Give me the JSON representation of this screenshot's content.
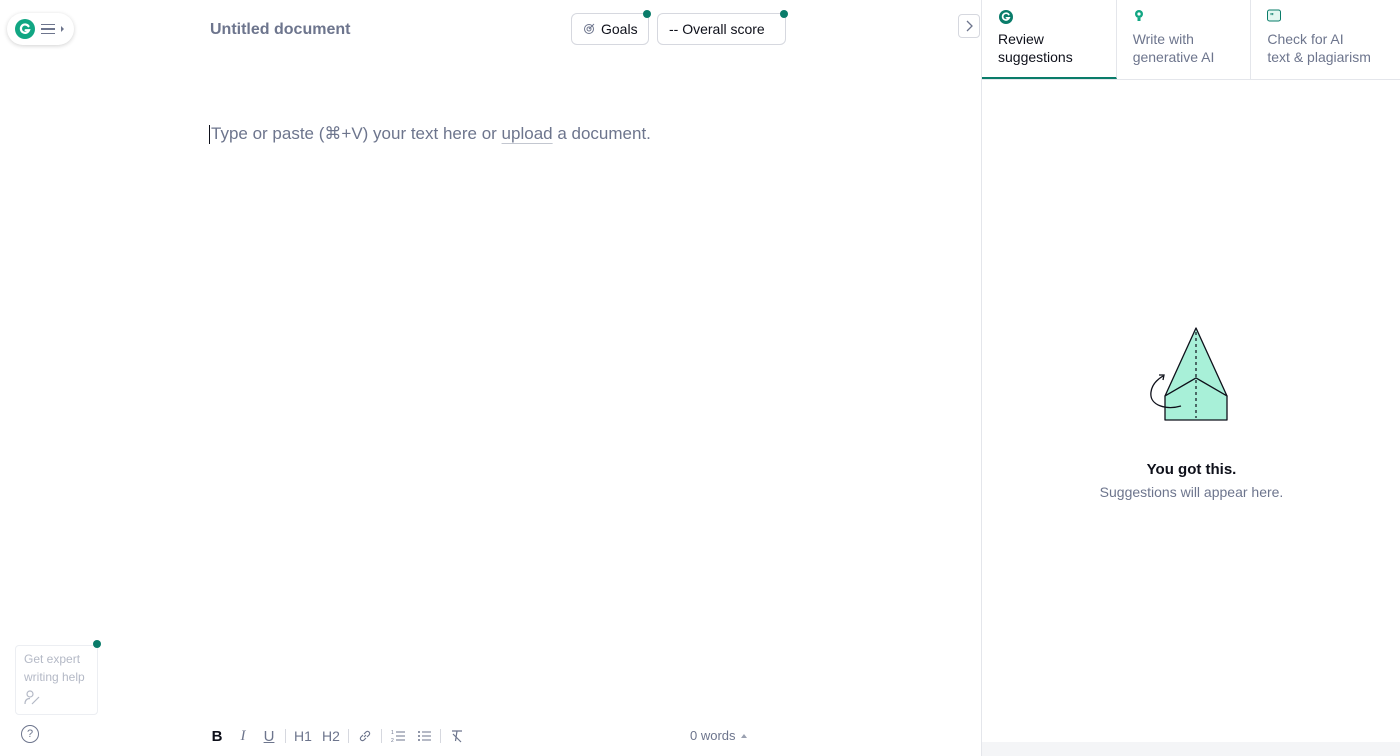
{
  "header": {
    "doc_title": "Untitled document",
    "goals_label": "Goals",
    "score_label": "-- Overall score"
  },
  "editor": {
    "placeholder_before": "Type or paste (⌘+V) your text here or ",
    "upload_link": "upload",
    "placeholder_after": " a document."
  },
  "expert": {
    "line1": "Get expert",
    "line2": "writing help"
  },
  "help": {
    "label": "?"
  },
  "toolbar": {
    "bold": "B",
    "italic": "I",
    "underline": "U",
    "h1": "H1",
    "h2": "H2",
    "word_count": "0 words"
  },
  "panel": {
    "tabs": [
      {
        "line1": "Review",
        "line2": "suggestions",
        "icon": "grammarly-icon"
      },
      {
        "line1": "Write with",
        "line2": "generative AI",
        "icon": "lightbulb-icon"
      },
      {
        "line1": "Check for AI",
        "line2": "text & plagiarism",
        "icon": "quote-icon"
      }
    ],
    "empty_title": "You got this.",
    "empty_subtitle": "Suggestions will appear here."
  },
  "colors": {
    "brand": "#11a683",
    "accent_dot": "#0a7c6a",
    "illustration_fill": "#a8f0d8"
  }
}
